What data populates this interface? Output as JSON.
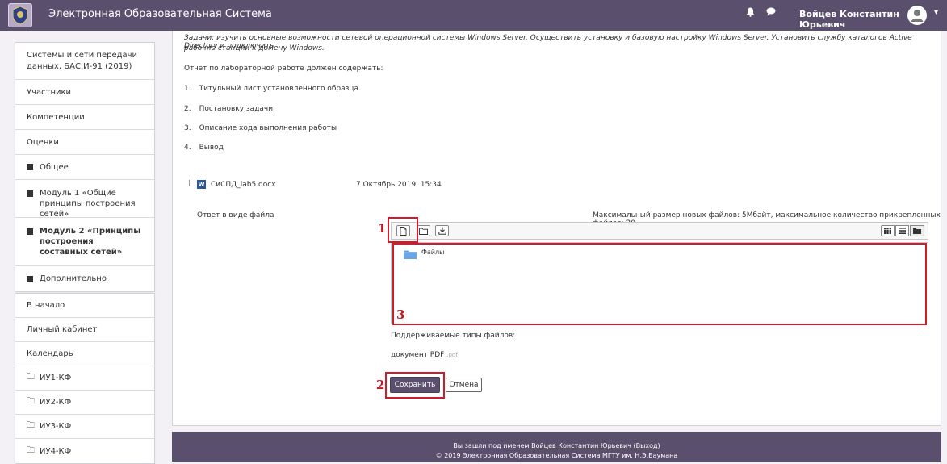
{
  "header": {
    "site_name": "Электронная Образовательная Система",
    "user_name": "Войцев Константин Юрьевич",
    "bell_icon": "bell-icon",
    "chat_icon": "chat-icon",
    "caret": "▾"
  },
  "sidebar": {
    "course_items": [
      {
        "label": "Системы и сети передачи данных, БАС.И-91 (2019)"
      },
      {
        "label": "Участники"
      },
      {
        "label": "Компетенции"
      },
      {
        "label": "Оценки"
      },
      {
        "label": "Общее"
      },
      {
        "label": "Модуль 1 «Общие принципы построения сетей»"
      },
      {
        "label": "Модуль 2 «Принципы построения составных сетей»"
      },
      {
        "label": "Дополнительно"
      }
    ],
    "nav_items": [
      {
        "label": "В начало"
      },
      {
        "label": "Личный кабинет"
      },
      {
        "label": "Календарь"
      },
      {
        "label": "ИУ1-КФ"
      },
      {
        "label": "ИУ2-КФ"
      },
      {
        "label": "ИУ3-КФ"
      },
      {
        "label": "ИУ4-КФ"
      }
    ]
  },
  "assignment": {
    "task_line1": "Задачи: изучить основные возможности сетевой операционной системы Windows Server. Осуществить установку и базовую настройку Windows Server. Установить службу каталогов Active Directory и подключить",
    "task_line2": "рабочие станции к домену Windows.",
    "report_intro": "Отчет по лабораторной работе должен содержать:",
    "items": [
      {
        "num": "1.",
        "text": "Титульный лист установленного образца."
      },
      {
        "num": "2.",
        "text": "Постановку задачи."
      },
      {
        "num": "3.",
        "text": "Описание хода выполнения работы"
      },
      {
        "num": "4.",
        "text": "Вывод"
      }
    ],
    "attachment_name": "СиСПД_lab5.docx",
    "attachment_date": "7 Октябрь 2019, 15:34"
  },
  "submission": {
    "label": "Ответ в виде файла",
    "limits": "Максимальный размер новых файлов: 5Мбайт, максимальное количество прикрепленных файлов: 20",
    "folder_name": "Файлы",
    "supported_label": "Поддерживаемые типы файлов:",
    "file_type": "документ PDF",
    "file_ext": ".pdf",
    "save_label": "Сохранить",
    "cancel_label": "Отмена"
  },
  "annotations": {
    "one": "1",
    "two": "2",
    "three": "3"
  },
  "footer": {
    "logged_prefix": "Вы зашли под именем",
    "user_link": "Войцев Константин Юрьевич",
    "logout_link": "(Выход)",
    "copyright": "© 2019 Электронная Образовательная Система МГТУ им. Н.Э.Баумана"
  },
  "colors": {
    "brand": "#5b4f6e",
    "annotation": "#d21a2b",
    "folder": "#6aa6e6"
  }
}
